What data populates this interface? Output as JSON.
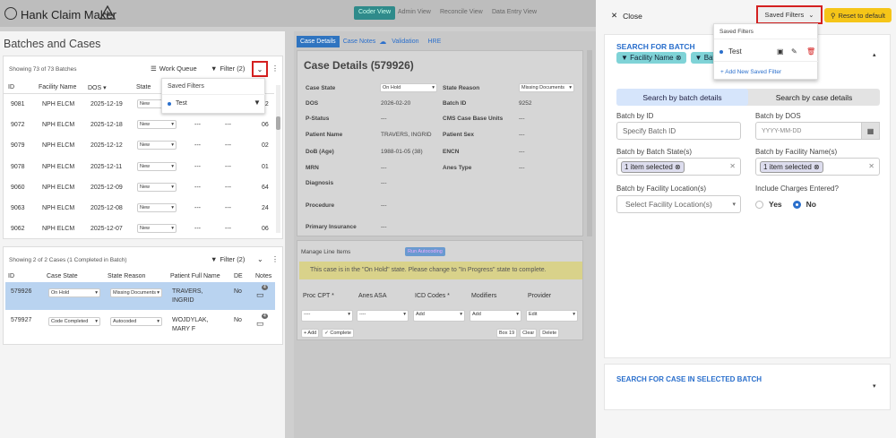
{
  "app": {
    "title": "Hank Claim Maker"
  },
  "nav": [
    "Coder View",
    "Admin View",
    "Reconcile View",
    "Data Entry View"
  ],
  "left": {
    "title": "Batches and Cases",
    "batches": {
      "showing": "Showing 73 of 73 Batches",
      "work_queue": "Work Queue",
      "filter": "Filter (2)",
      "columns": [
        "ID",
        "Facility Name",
        "DOS",
        "State"
      ],
      "extra_cols": [
        "---",
        "---"
      ],
      "rows": [
        {
          "id": "9081",
          "facility": "NPH ELCM",
          "dos": "2025-12-19",
          "state": "New",
          "c1": "---",
          "c2": "---",
          "n": "02"
        },
        {
          "id": "9072",
          "facility": "NPH ELCM",
          "dos": "2025-12-18",
          "state": "New",
          "c1": "---",
          "c2": "---",
          "n": "06"
        },
        {
          "id": "9079",
          "facility": "NPH ELCM",
          "dos": "2025-12-12",
          "state": "New",
          "c1": "---",
          "c2": "---",
          "n": "02"
        },
        {
          "id": "9078",
          "facility": "NPH ELCM",
          "dos": "2025-12-11",
          "state": "New",
          "c1": "---",
          "c2": "---",
          "n": "01"
        },
        {
          "id": "9060",
          "facility": "NPH ELCM",
          "dos": "2025-12-09",
          "state": "New",
          "c1": "---",
          "c2": "---",
          "n": "64"
        },
        {
          "id": "9063",
          "facility": "NPH ELCM",
          "dos": "2025-12-08",
          "state": "New",
          "c1": "---",
          "c2": "---",
          "n": "24"
        },
        {
          "id": "9062",
          "facility": "NPH ELCM",
          "dos": "2025-12-07",
          "state": "New",
          "c1": "---",
          "c2": "---",
          "n": "06"
        }
      ],
      "dropdown": {
        "title": "Saved Filters",
        "item": "Test"
      }
    },
    "cases": {
      "showing": "Showing 2 of 2 Cases (1 Completed in Batch)",
      "filter": "Filter (2)",
      "columns": [
        "ID",
        "Case State",
        "State Reason",
        "Patient Full Name",
        "DE",
        "Notes"
      ],
      "rows": [
        {
          "id": "579926",
          "state": "On Hold",
          "reason": "Missing Documents",
          "name1": "TRAVERS,",
          "name2": "INGRID",
          "de": "No",
          "notes": "4"
        },
        {
          "id": "579927",
          "state": "Code Completed",
          "reason": "Autocoded",
          "name1": "WOJDYLAK,",
          "name2": "MARY F",
          "de": "No",
          "notes": "4"
        }
      ]
    }
  },
  "middle": {
    "tabs": [
      "Case Details",
      "Case Notes",
      "Validation",
      "HRE"
    ],
    "title": "Case Details (579926)",
    "fields_left": [
      {
        "label": "Case State",
        "value": "On Hold"
      },
      {
        "label": "DOS",
        "value": "2026-02-20"
      },
      {
        "label": "P-Status",
        "value": "---"
      },
      {
        "label": "Patient Name",
        "value": "TRAVERS, INGRID"
      },
      {
        "label": "DoB (Age)",
        "value": "1988-01-05 (38)"
      },
      {
        "label": "MRN",
        "value": "---"
      },
      {
        "label": "Diagnosis",
        "value": "---"
      },
      {
        "label": "Procedure",
        "value": "---"
      },
      {
        "label": "Primary Insurance",
        "value": "---"
      }
    ],
    "fields_right": [
      {
        "label": "State Reason",
        "value": "Missing Documents"
      },
      {
        "label": "Batch ID",
        "value": "9252"
      },
      {
        "label": "CMS Case Base Units",
        "value": "---"
      },
      {
        "label": "Patient Sex",
        "value": "---"
      },
      {
        "label": "ENCN",
        "value": "---"
      },
      {
        "label": "Anes Type",
        "value": "---"
      }
    ],
    "line_items": {
      "title": "Manage Line Items",
      "run_btn": "Run Autocoding",
      "warning": "This case is in the \"On Hold\" state. Please change to \"In Progress\" state to complete.",
      "columns": [
        "Proc CPT *",
        "Anes ASA",
        "ICD Codes *",
        "Modifiers",
        "Provider"
      ],
      "inputs": [
        "----",
        "----",
        "Add",
        "Add",
        "Edit"
      ],
      "buttons": [
        "+ Add",
        "✓ Complete",
        "Box 19",
        "Clear",
        "Delete"
      ]
    }
  },
  "right": {
    "close": "Close",
    "saved_filters": "Saved Filters",
    "reset": "Reset to default",
    "sf_dropdown": {
      "title": "Saved Filters",
      "item": "Test",
      "add": "+ Add New Saved Filter"
    },
    "search_batch": {
      "title": "SEARCH FOR BATCH",
      "chips": [
        "Facility Name",
        "Bat"
      ],
      "tab_details": "Search by batch details",
      "tab_case": "Search by case details",
      "batch_id_label": "Batch by ID",
      "batch_id_ph": "Specify Batch ID",
      "dos_label": "Batch by DOS",
      "dos_ph": "YYYY-MM-DD",
      "state_label": "Batch by Batch State(s)",
      "state_value": "1 item selected",
      "facility_label": "Batch by Facility Name(s)",
      "facility_value": "1 item selected",
      "location_label": "Batch by Facility Location(s)",
      "location_ph": "Select Facility Location(s)",
      "charges_label": "Include Charges Entered?",
      "yes": "Yes",
      "no": "No"
    },
    "search_case": {
      "title": "SEARCH FOR CASE IN SELECTED BATCH"
    }
  },
  "colors": {
    "accent": "#2a6fcc",
    "highlight": "#f5c518",
    "red": "#d42020",
    "teal": "#7fd3d7"
  }
}
